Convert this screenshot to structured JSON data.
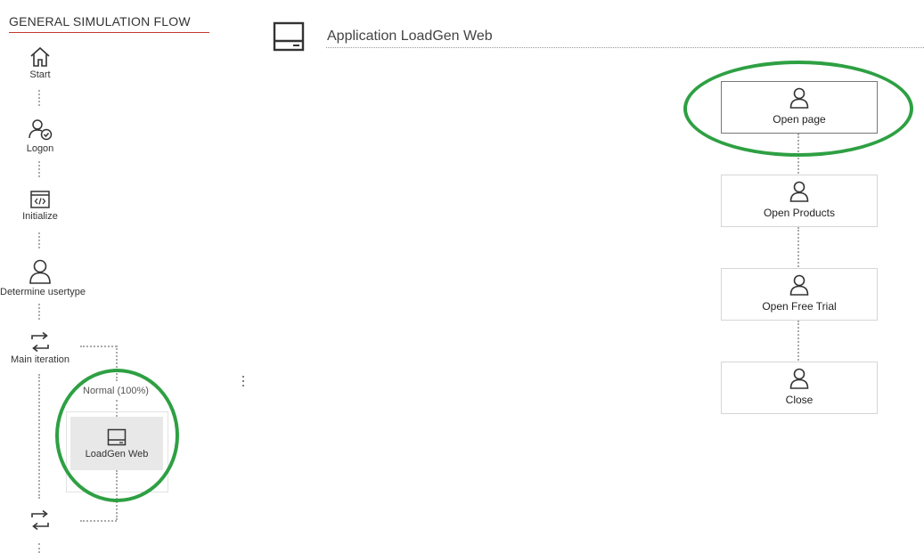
{
  "left_panel": {
    "title": "GENERAL SIMULATION FLOW",
    "items": [
      {
        "label": "Start",
        "icon": "home-icon"
      },
      {
        "label": "Logon",
        "icon": "user-check-icon"
      },
      {
        "label": "Initialize",
        "icon": "code-window-icon"
      },
      {
        "label": "Determine usertype",
        "icon": "user-icon"
      },
      {
        "label": "Main iteration",
        "icon": "loop-icon"
      }
    ],
    "branch_label": "Normal (100%)",
    "block_label": "LoadGen Web",
    "bottom_icon": "loop-icon"
  },
  "main": {
    "title": "Application LoadGen Web",
    "steps": [
      {
        "label": "Open page"
      },
      {
        "label": "Open Products"
      },
      {
        "label": "Open Free Trial"
      },
      {
        "label": "Close"
      }
    ]
  },
  "colors": {
    "accent_line": "#c0392b",
    "highlight_ellipse": "#2ea043"
  }
}
